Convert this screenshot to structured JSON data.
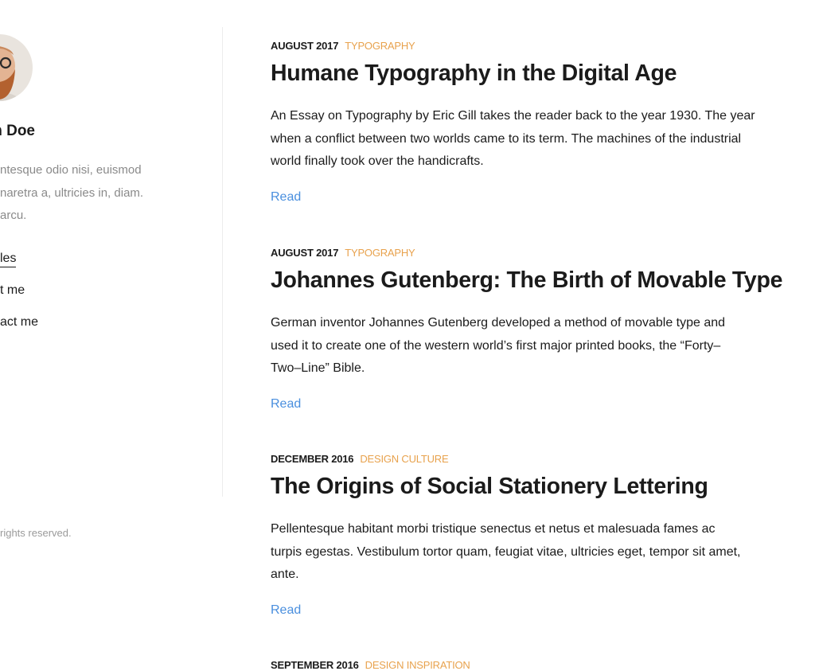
{
  "sidebar": {
    "author_name": "n Doe",
    "bio_lines": [
      "ntesque odio nisi, euismod",
      "naretra a, ultricies in, diam.",
      "arcu."
    ],
    "nav": [
      {
        "label": "les",
        "active": true
      },
      {
        "label": "t me",
        "active": false
      },
      {
        "label": "act me",
        "active": false
      }
    ],
    "copyright": "rights reserved."
  },
  "posts": [
    {
      "date": "AUGUST 2017",
      "category": "TYPOGRAPHY",
      "title": "Humane Typography in the Digital Age",
      "excerpt_lines": [
        "An Essay on Typography by Eric Gill takes the reader back to the year 1930. The year",
        "when a conflict between two worlds came to its term. The machines of the industrial",
        "world finally took over the handicrafts."
      ],
      "read_label": "Read"
    },
    {
      "date": "AUGUST 2017",
      "category": "TYPOGRAPHY",
      "title": "Johannes Gutenberg: The Birth of Movable Type",
      "excerpt_lines": [
        "German inventor Johannes Gutenberg developed a method of movable type and",
        "used it to create one of the western world’s first major printed books, the “Forty–",
        "Two–Line” Bible."
      ],
      "read_label": "Read"
    },
    {
      "date": "DECEMBER 2016",
      "category": "DESIGN CULTURE",
      "title": "The Origins of Social Stationery Lettering",
      "excerpt_lines": [
        "Pellentesque habitant morbi tristique senectus et netus et malesuada fames ac",
        "turpis egestas. Vestibulum tortor quam, feugiat vitae, ultricies eget, tempor sit amet,",
        "ante."
      ],
      "read_label": "Read"
    },
    {
      "date": "SEPTEMBER 2016",
      "category": "DESIGN INSPIRATION"
    }
  ],
  "colors": {
    "category": "#e8a24d",
    "link": "#4a8fde",
    "text": "#1b1b1b",
    "muted": "#8a8a8a"
  }
}
